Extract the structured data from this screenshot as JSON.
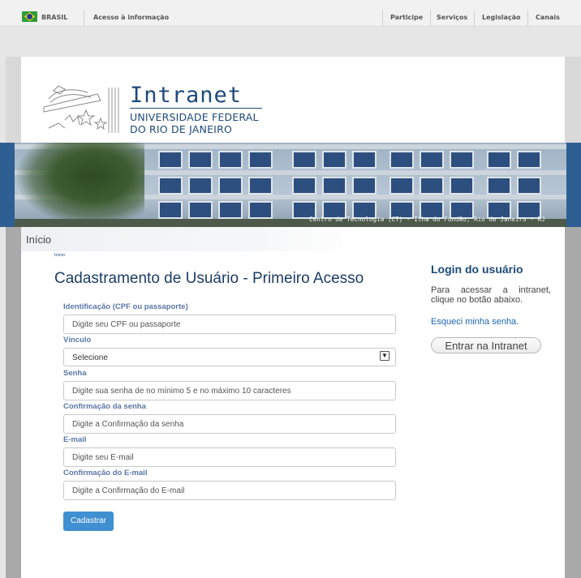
{
  "govbar": {
    "brasil": "BRASIL",
    "acesso": "Acesso à informação",
    "links": [
      "Participe",
      "Serviços",
      "Legislação",
      "Canais"
    ]
  },
  "header": {
    "title": "Intranet",
    "subtitle_line1": "UNIVERSIDADE FEDERAL",
    "subtitle_line2": "DO RIO DE JANEIRO"
  },
  "banner": {
    "caption": "Centro de Tecnologia (CT) - Ilha do Fundão, Rio de Janeiro - RJ"
  },
  "breadcrumb": {
    "title": "Início",
    "small": "Início"
  },
  "form": {
    "title": "Cadastramento de Usuário - Primeiro Acesso",
    "fields": {
      "cpf": {
        "label": "Identificação (CPF ou passaporte)",
        "placeholder": "Digite seu CPF ou passaporte"
      },
      "vinculo": {
        "label": "Vínculo",
        "selected": "Selecione"
      },
      "senha": {
        "label": "Senha",
        "placeholder": "Digite sua senha de no mínimo 5 e no máximo 10 caracteres"
      },
      "conf_senha": {
        "label": "Confirmação da senha",
        "placeholder": "Digite a Confirmação da senha"
      },
      "email": {
        "label": "E-mail",
        "placeholder": "Digite seu E-mail"
      },
      "conf_email": {
        "label": "Confirmação do E-mail",
        "placeholder": "Digite a Confirmação do E-mail"
      }
    },
    "submit": "Cadastrar"
  },
  "login": {
    "title": "Login do usuário",
    "description": "Para acessar a intranet, clique no botão abaixo.",
    "forgot": "Esqueci minha senha.",
    "button": "Entrar na Intranet"
  },
  "icons": {
    "flag": "brazil-flag-icon",
    "select_arrow": "chevron-down-icon"
  }
}
